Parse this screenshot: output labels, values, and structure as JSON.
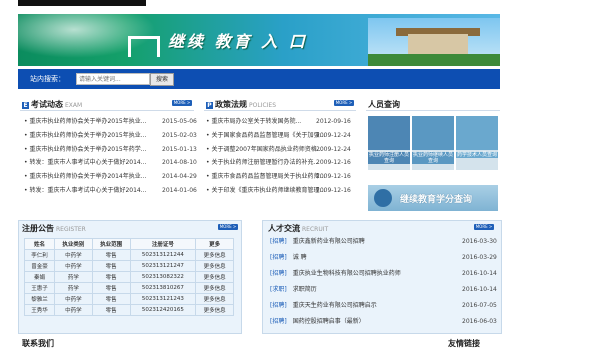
{
  "banner": {
    "title": "继续 教育 入 口"
  },
  "search": {
    "label": "站内搜索：",
    "placeholder": "请输入关键词...",
    "button": "搜索"
  },
  "exam": {
    "title": "考试动态",
    "subtitle": "EXAM",
    "more": "MORE >",
    "items": [
      {
        "title": "重庆市执业药师协会关于举办2015年执业...",
        "date": "2015-05-06"
      },
      {
        "title": "重庆市执业药师协会关于举办2015年执业...",
        "date": "2015-02-03"
      },
      {
        "title": "重庆市执业药师协会关于举办2015年药学...",
        "date": "2015-01-13"
      },
      {
        "title": "转发：重庆市人事考试中心关于做好2014...",
        "date": "2014-08-10"
      },
      {
        "title": "重庆市执业药师协会关于举办2014年执业...",
        "date": "2014-04-29"
      },
      {
        "title": "转发：重庆市人事考试中心关于做好2014...",
        "date": "2014-01-06"
      }
    ]
  },
  "policy": {
    "title": "政策法规",
    "subtitle": "POLICIES",
    "more": "MORE >",
    "items": [
      {
        "title": "重庆市局办公室关于转发国务院...",
        "date": "2012-09-16"
      },
      {
        "title": "关于国家食品药品监督管理局《关于加强...",
        "date": "2009-12-24"
      },
      {
        "title": "关于调整2007年国家药品执业药师资格...",
        "date": "2009-12-24"
      },
      {
        "title": "关于执业药师注册管理暂行办法的补充...",
        "date": "2009-12-16"
      },
      {
        "title": "重庆市食品药品监督管理局关于执业药师...",
        "date": "2009-12-16"
      },
      {
        "title": "关于印发《重庆市执业药师继续教育管理...",
        "date": "2009-12-16"
      }
    ]
  },
  "query": {
    "title": "人员查询",
    "services": [
      {
        "label": "执业药师注册人员查询",
        "color": "#4d86b4"
      },
      {
        "label": "执业药师继续人员查询",
        "color": "#5a98c2"
      },
      {
        "label": "药学技术人员查询",
        "color": "#6aa8ce"
      }
    ],
    "big_button": "继续教育学分查询"
  },
  "register": {
    "title": "注册公告",
    "subtitle": "REGISTER",
    "more": "MORE >",
    "columns": [
      "姓名",
      "执业类别",
      "执业范围",
      "注册证号",
      "更多"
    ],
    "rows": [
      [
        "李仁利",
        "中药学",
        "零售",
        "502313121244",
        "更多信息"
      ],
      [
        "曾金豪",
        "中药学",
        "零售",
        "502313121247",
        "更多信息"
      ],
      [
        "秦娟",
        "药学",
        "零售",
        "502313082322",
        "更多信息"
      ],
      [
        "王惠子",
        "药学",
        "零售",
        "502313810267",
        "更多信息"
      ],
      [
        "黎雅兰",
        "中药学",
        "零售",
        "502313121243",
        "更多信息"
      ],
      [
        "王秀华",
        "中药学",
        "零售",
        "502312420165",
        "更多信息"
      ]
    ]
  },
  "talent": {
    "title": "人才交流",
    "subtitle": "RECRUIT",
    "more": "MORE >",
    "items": [
      {
        "tag": "[招聘]",
        "title": "重庆鑫新药业有限公司招聘",
        "date": "2016-03-30"
      },
      {
        "tag": "[招聘]",
        "title": "诚 聘",
        "date": "2016-03-29"
      },
      {
        "tag": "[招聘]",
        "title": "重庆执业生物科技有限公司招聘执业药师",
        "date": "2016-10-14"
      },
      {
        "tag": "[求职]",
        "title": "求职简历",
        "date": "2016-10-14"
      },
      {
        "tag": "[招聘]",
        "title": "重庆天生药业有限公司招聘启示",
        "date": "2016-07-05"
      },
      {
        "tag": "[招聘]",
        "title": "国药控股招聘启事（最新）",
        "date": "2016-06-03"
      }
    ]
  },
  "footer_hint": {
    "left": "联系我们",
    "right": "友情链接"
  }
}
